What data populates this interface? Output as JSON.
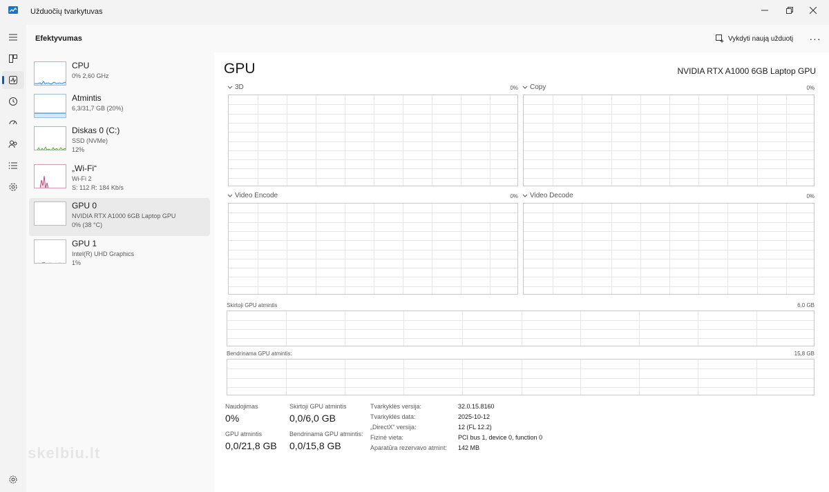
{
  "window": {
    "title": "Užduočių tvarkytuvas"
  },
  "header": {
    "page_title": "Efektyvumas",
    "run_task_label": "Vykdyti naują užduotį",
    "more_label": "···"
  },
  "nav": {
    "items": [
      "menu-icon",
      "processes-icon",
      "performance-icon",
      "app-history-icon",
      "startup-apps-icon",
      "users-icon",
      "details-icon",
      "services-icon"
    ],
    "settings": "settings-icon"
  },
  "resources": [
    {
      "name": "CPU",
      "line1": "0% 2,60 GHz",
      "line2": ""
    },
    {
      "name": "Atmintis",
      "line1": "6,3/31,7 GB (20%)",
      "line2": ""
    },
    {
      "name": "Diskas 0 (C:)",
      "line1": "SSD (NVMe)",
      "line2": "12%"
    },
    {
      "name": "„Wi-Fi“",
      "line1": "Wi-Fi 2",
      "line2": "S: 112 R: 184 Kb/s"
    },
    {
      "name": "GPU 0",
      "line1": "NVIDIA RTX A1000 6GB Laptop GPU",
      "line2": "0% (38 °C)"
    },
    {
      "name": "GPU 1",
      "line1": "Intel(R) UHD Graphics",
      "line2": "1%"
    }
  ],
  "main": {
    "title": "GPU",
    "model": "NVIDIA RTX A1000 6GB Laptop GPU",
    "engines": [
      {
        "label": "3D",
        "percent": "0%"
      },
      {
        "label": "Copy",
        "percent": "0%"
      },
      {
        "label": "Video Encode",
        "percent": "0%"
      },
      {
        "label": "Video Decode",
        "percent": "0%"
      }
    ],
    "dedicated_mem_label": "Skirtoji GPU atmintis",
    "dedicated_mem_max": "6,0 GB",
    "shared_mem_label": "Bendrinama GPU atmintis:",
    "shared_mem_max": "15,8 GB"
  },
  "stats": {
    "utilization_label": "Naudojimas",
    "utilization_value": "0%",
    "dedicated_label": "Skirtoji GPU atmintis",
    "dedicated_value": "0,0/6,0 GB",
    "gpu_mem_label": "GPU atmintis",
    "gpu_mem_value": "0,0/21,8 GB",
    "shared_label": "Bendrinama GPU atmintis:",
    "shared_value": "0,0/15,8 GB"
  },
  "properties": [
    {
      "key": "Tvarkyklės versija:",
      "value": "32.0.15.8160"
    },
    {
      "key": "Tvarkyklės data:",
      "value": "2025-10-12"
    },
    {
      "key": "„DirectX“ versija:",
      "value": "12 (FL 12.2)"
    },
    {
      "key": "Fizinė vieta:",
      "value": "PCI bus 1, device 0, function 0"
    },
    {
      "key": "Aparatūra rezervavo atmint:",
      "value": "142 MB"
    }
  ],
  "watermark": "skelbiu.lt",
  "colors": {
    "accent": "#005fb8",
    "cpu_graph": "#1874c8",
    "disk_graph": "#4e9a28",
    "wifi_graph": "#b0306a",
    "grid": "#e6e6e6"
  }
}
